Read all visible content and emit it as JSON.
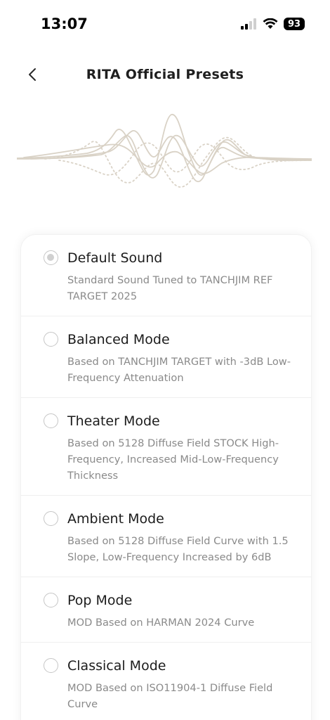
{
  "status": {
    "time": "13:07",
    "battery": "93",
    "signal_icon": "cellular-signal-icon",
    "wifi_icon": "wifi-icon"
  },
  "header": {
    "title": "RITA Official Presets",
    "back_icon": "chevron-left-icon"
  },
  "presets": [
    {
      "title": "Default Sound",
      "desc": "Standard Sound Tuned to TANCHJIM REF TARGET 2025",
      "selected": true
    },
    {
      "title": "Balanced Mode",
      "desc": "Based on TANCHJIM TARGET with -3dB Low-Frequency Attenuation",
      "selected": false
    },
    {
      "title": "Theater Mode",
      "desc": "Based on 5128 Diffuse Field STOCK High-Frequency, Increased Mid-Low-Frequency Thickness",
      "selected": false
    },
    {
      "title": "Ambient Mode",
      "desc": "Based on 5128 Diffuse Field Curve with 1.5 Slope, Low-Frequency Increased by 6dB",
      "selected": false
    },
    {
      "title": "Pop Mode",
      "desc": "MOD Based on HARMAN 2024 Curve",
      "selected": false
    },
    {
      "title": "Classical Mode",
      "desc": "MOD Based on ISO11904-1 Diffuse Field Curve",
      "selected": false
    }
  ],
  "colors": {
    "wave": "#d9d2c6",
    "radio_border": "#c6c6c6",
    "radio_selected_dot": "#d0d0d0",
    "desc_text": "#8a8a8a"
  }
}
